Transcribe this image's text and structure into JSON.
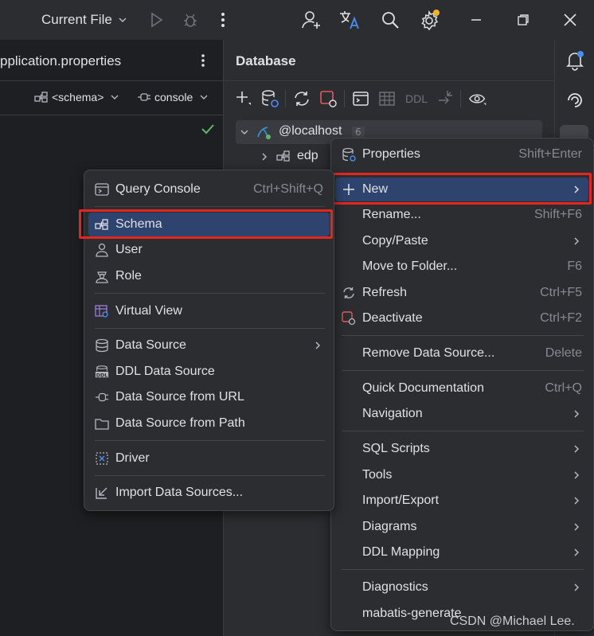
{
  "titlebar": {
    "current_file": "Current File"
  },
  "editor": {
    "tab_title": "pplication.properties",
    "schema_label": "<schema>",
    "console_label": "console"
  },
  "database": {
    "title": "Database",
    "ddl_label": "DDL",
    "tree": {
      "root_label": "@localhost",
      "root_count": "6",
      "child_label": "edp"
    }
  },
  "context_menu": {
    "items": [
      {
        "label": "Properties",
        "shortcut": "Shift+Enter"
      },
      {
        "label": "New"
      },
      {
        "label": "Rename...",
        "shortcut": "Shift+F6"
      },
      {
        "label": "Copy/Paste"
      },
      {
        "label": "Move to Folder...",
        "shortcut": "F6"
      },
      {
        "label": "Refresh",
        "shortcut": "Ctrl+F5"
      },
      {
        "label": "Deactivate",
        "shortcut": "Ctrl+F2"
      },
      {
        "label": "Remove Data Source...",
        "shortcut": "Delete"
      },
      {
        "label": "Quick Documentation",
        "shortcut": "Ctrl+Q"
      },
      {
        "label": "Navigation"
      },
      {
        "label": "SQL Scripts"
      },
      {
        "label": "Tools"
      },
      {
        "label": "Import/Export"
      },
      {
        "label": "Diagrams"
      },
      {
        "label": "DDL Mapping"
      },
      {
        "label": "Diagnostics"
      },
      {
        "label": "mabatis-generate"
      }
    ]
  },
  "new_submenu": {
    "items": [
      {
        "label": "Query Console",
        "shortcut": "Ctrl+Shift+Q"
      },
      {
        "label": "Schema"
      },
      {
        "label": "User"
      },
      {
        "label": "Role"
      },
      {
        "label": "Virtual View"
      },
      {
        "label": "Data Source"
      },
      {
        "label": "DDL Data Source"
      },
      {
        "label": "Data Source from URL"
      },
      {
        "label": "Data Source from Path"
      },
      {
        "label": "Driver"
      },
      {
        "label": "Import Data Sources..."
      }
    ]
  },
  "watermark": "CSDN @Michael Lee.",
  "colors": {
    "selection": "#2e436e",
    "highlight_box": "#e5261e",
    "panel": "#2b2d30",
    "editor": "#1e1f22",
    "accent": "#3574f0"
  }
}
